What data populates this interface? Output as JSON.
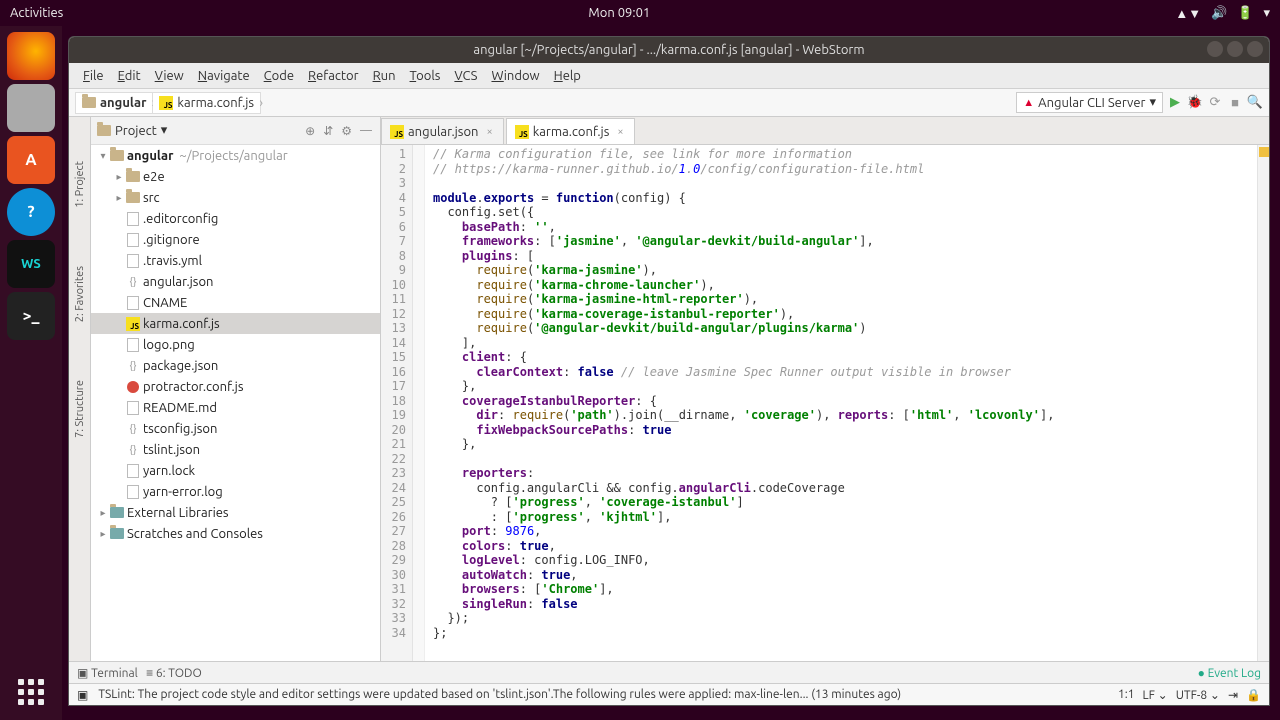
{
  "sysbar": {
    "activities": "Activities",
    "clock": "Mon 09:01"
  },
  "window": {
    "title": "angular [~/Projects/angular] - .../karma.conf.js [angular] - WebStorm",
    "menus": [
      "File",
      "Edit",
      "View",
      "Navigate",
      "Code",
      "Refactor",
      "Run",
      "Tools",
      "VCS",
      "Window",
      "Help"
    ],
    "breadcrumbs": [
      "angular",
      "karma.conf.js"
    ],
    "run_config": "Angular CLI Server"
  },
  "sidebar_tabs": [
    "1: Project",
    "2: Favorites",
    "7: Structure"
  ],
  "project_panel": {
    "title": "Project"
  },
  "tree": {
    "root": {
      "name": "angular",
      "path": "~/Projects/angular"
    },
    "dirs": [
      "e2e",
      "src"
    ],
    "files": [
      {
        "name": ".editorconfig",
        "icon": "file"
      },
      {
        "name": ".gitignore",
        "icon": "file"
      },
      {
        "name": ".travis.yml",
        "icon": "file"
      },
      {
        "name": "angular.json",
        "icon": "json"
      },
      {
        "name": "CNAME",
        "icon": "file"
      },
      {
        "name": "karma.conf.js",
        "icon": "js",
        "selected": true
      },
      {
        "name": "logo.png",
        "icon": "file"
      },
      {
        "name": "package.json",
        "icon": "json"
      },
      {
        "name": "protractor.conf.js",
        "icon": "red"
      },
      {
        "name": "README.md",
        "icon": "file"
      },
      {
        "name": "tsconfig.json",
        "icon": "json"
      },
      {
        "name": "tslint.json",
        "icon": "json"
      },
      {
        "name": "yarn.lock",
        "icon": "file"
      },
      {
        "name": "yarn-error.log",
        "icon": "file"
      }
    ],
    "extras": [
      "External Libraries",
      "Scratches and Consoles"
    ]
  },
  "tabs": [
    {
      "name": "angular.json",
      "active": false
    },
    {
      "name": "karma.conf.js",
      "active": true
    }
  ],
  "code_lines": [
    "// Karma configuration file, see link for more information",
    "// https://karma-runner.github.io/1.0/config/configuration-file.html",
    "",
    "module.exports = function(config) {",
    "  config.set({",
    "    basePath: '',",
    "    frameworks: ['jasmine', '@angular-devkit/build-angular'],",
    "    plugins: [",
    "      require('karma-jasmine'),",
    "      require('karma-chrome-launcher'),",
    "      require('karma-jasmine-html-reporter'),",
    "      require('karma-coverage-istanbul-reporter'),",
    "      require('@angular-devkit/build-angular/plugins/karma')",
    "    ],",
    "    client: {",
    "      clearContext: false // leave Jasmine Spec Runner output visible in browser",
    "    },",
    "    coverageIstanbulReporter: {",
    "      dir: require('path').join(__dirname, 'coverage'), reports: ['html', 'lcovonly'],",
    "      fixWebpackSourcePaths: true",
    "    },",
    "",
    "    reporters:",
    "      config.angularCli && config.angularCli.codeCoverage",
    "        ? ['progress', 'coverage-istanbul']",
    "        : ['progress', 'kjhtml'],",
    "    port: 9876,",
    "    colors: true,",
    "    logLevel: config.LOG_INFO,",
    "    autoWatch: true,",
    "    browsers: ['Chrome'],",
    "    singleRun: false",
    "  });",
    "};"
  ],
  "toolwindows": {
    "terminal": "Terminal",
    "todo": "6: TODO",
    "eventlog": "Event Log"
  },
  "status": {
    "message": "TSLint: The project code style and editor settings were updated based on 'tslint.json'.The following rules were applied: max-line-len... (13 minutes ago)",
    "pos": "1:1",
    "le": "LF",
    "enc": "UTF-8"
  }
}
